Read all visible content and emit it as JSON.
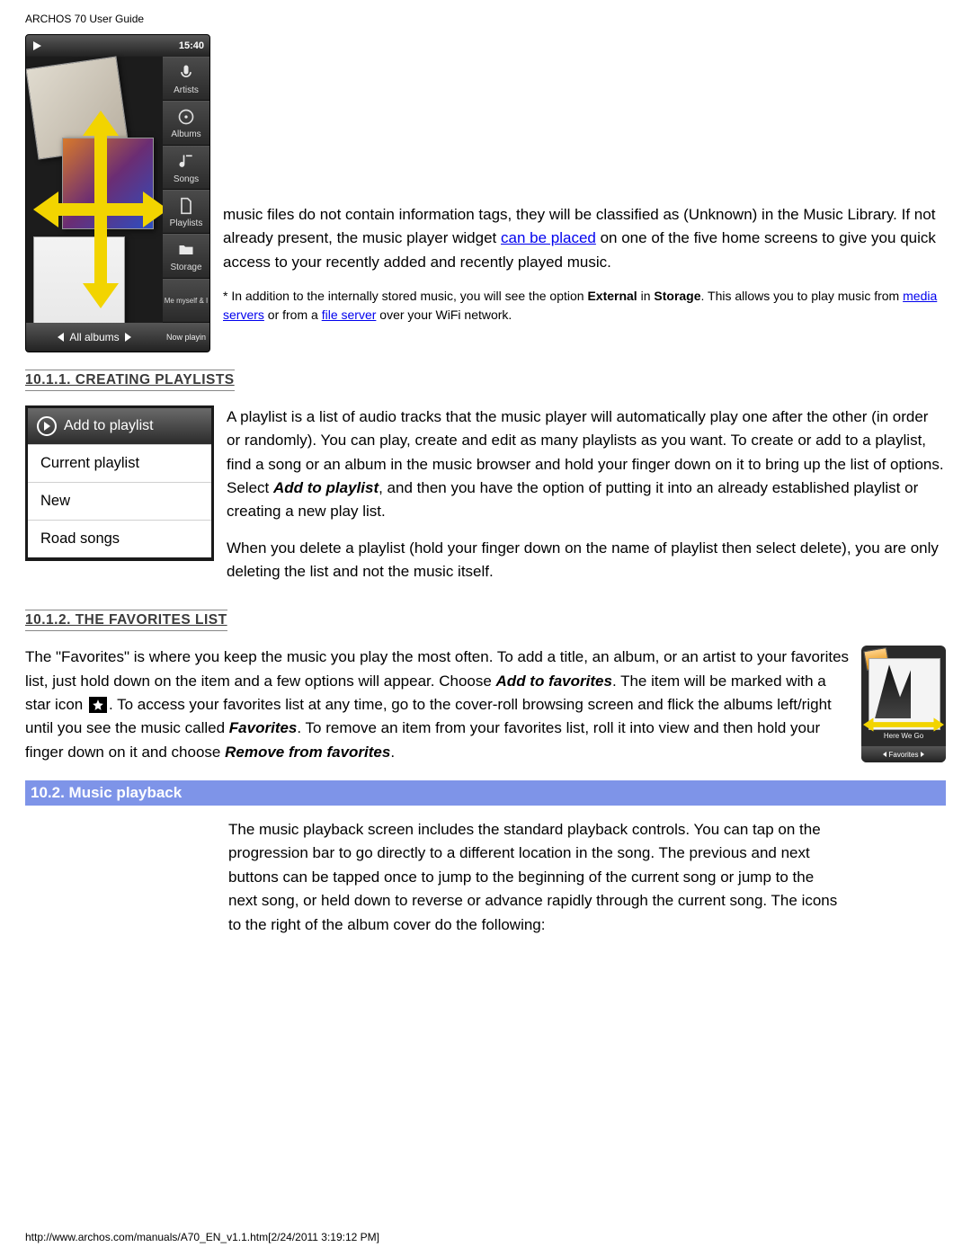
{
  "doc": {
    "title": "ARCHOS 70 User Guide",
    "footer": "http://www.archos.com/manuals/A70_EN_v1.1.htm[2/24/2011 3:19:12 PM]"
  },
  "shot1": {
    "time": "15:40",
    "items": [
      "Artists",
      "Albums",
      "Songs",
      "Playlists",
      "Storage",
      "Me myself & I"
    ],
    "bottom_label": "All albums",
    "now_playing": "Now playin"
  },
  "intro": {
    "p1a": "music files do not contain information tags, they will be classified as (Unknown) in the Music Library. If not already present, the music player widget ",
    "link1": "can be placed",
    "p1b": " on one of the five home screens to give you quick access to your recently added and recently played music.",
    "fn_a": "* In addition to the internally stored music, you will see the option ",
    "fn_ext": "External",
    "fn_b": " in ",
    "fn_store": "Storage",
    "fn_c": ".  This allows you to play music from ",
    "fn_link1": "media servers",
    "fn_d": " or from a ",
    "fn_link2": "file server",
    "fn_e": " over your WiFi network."
  },
  "sec1011": {
    "title": "10.1.1. CREATING PLAYLISTS",
    "apbox": {
      "header": "Add to playlist",
      "items": [
        "Current playlist",
        "New",
        "Road songs"
      ]
    },
    "p_a": "A playlist is a list of audio tracks that the music player will automatically play one after the other (in order or randomly). You can play, create and edit as many playlists as you want. To create or add to a playlist, find a song or an album in the music browser and hold your finger down on it to bring up the list of options. Select ",
    "p_b": "Add to playlist",
    "p_c": ", and then you have the option of putting it into an already established playlist or creating a new play list.",
    "p2": "When you delete a playlist (hold your finger down on the name of playlist then select delete), you are only deleting the list and not the music itself."
  },
  "sec1012": {
    "title": "10.1.2. THE FAVORITES LIST",
    "p_a": "The \"Favorites\" is where you keep the music you play the most often. To add a title, an album, or an artist to your favorites list, just hold down on the item and a few options will appear. Choose ",
    "p_b": "Add to favorites",
    "p_c": ". The item will be marked with a star icon ",
    "p_d": ". To access your favorites list at any time, go to the cover-roll browsing screen and flick the albums left/right until you see the music called ",
    "p_e": "Favorites",
    "p_f": ". To remove an item from your favorites list, roll it into view and then hold your finger down on it and choose ",
    "p_g": "Remove from favorites",
    "p_h": ".",
    "thumb_caption": "Here We Go",
    "thumb_bb": "Favorites"
  },
  "sec102": {
    "title": "10.2. Music playback",
    "p": "The music playback screen includes the standard playback controls.  You can tap on the progression bar to go directly to a different location in the song. The previous and next buttons can be tapped once to jump to the beginning of the current song or jump to the next song, or held down to reverse or advance rapidly through the current song. The icons to the right of the album cover do the following:"
  }
}
